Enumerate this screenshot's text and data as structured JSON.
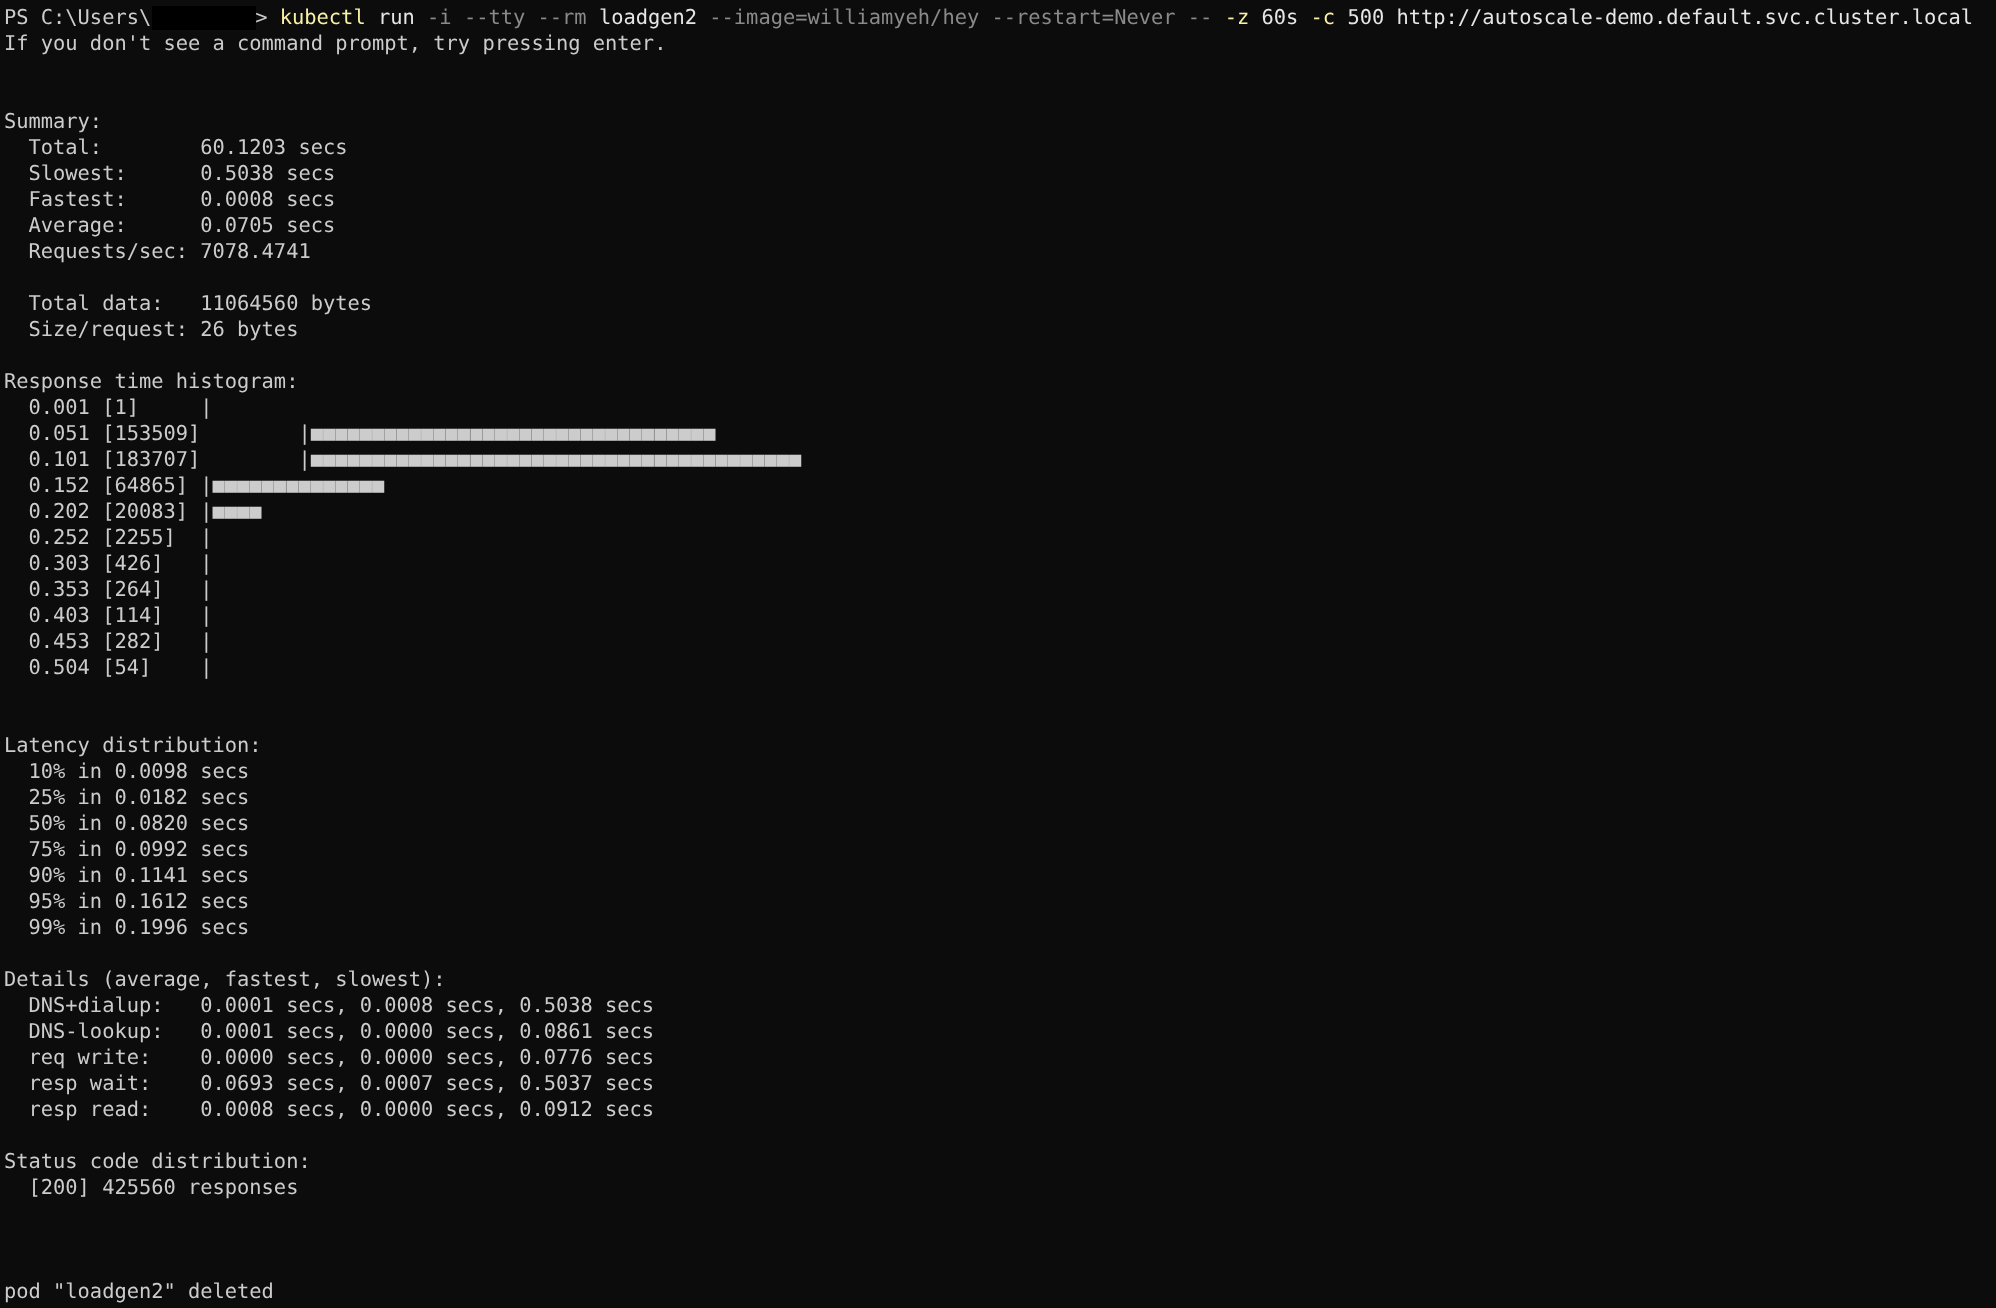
{
  "prompt": {
    "text": "PS C:\\Users\\",
    "redacted": true,
    "end": "> "
  },
  "command": [
    {
      "text": "kubectl",
      "kind": "command"
    },
    {
      "text": "run",
      "kind": "argument"
    },
    {
      "text": "-i",
      "kind": "flag"
    },
    {
      "text": "--tty",
      "kind": "flag"
    },
    {
      "text": "--rm",
      "kind": "flag"
    },
    {
      "text": "loadgen2",
      "kind": "argument"
    },
    {
      "text": "--image=williamyeh/hey",
      "kind": "flag"
    },
    {
      "text": "--restart=Never",
      "kind": "flag"
    },
    {
      "text": "--",
      "kind": "flag"
    },
    {
      "text": "-z",
      "kind": "parameter"
    },
    {
      "text": "60s",
      "kind": "argument"
    },
    {
      "text": "-c",
      "kind": "parameter"
    },
    {
      "text": "500",
      "kind": "argument"
    },
    {
      "text": "http://autoscale-demo.default.svc.cluster.local",
      "kind": "argument"
    }
  ],
  "output": [
    {
      "lines": [
        "If you don't see a command prompt, try pressing enter."
      ]
    },
    {
      "lines": [
        "Summary:",
        "  Total:        60.1203 secs",
        "  Slowest:      0.5038 secs",
        "  Fastest:      0.0008 secs",
        "  Average:      0.0705 secs",
        "  Requests/sec: 7078.4741"
      ]
    },
    {
      "lines": [
        "  Total data:   11064560 bytes",
        "  Size/request: 26 bytes"
      ]
    },
    {
      "histogram": {
        "title": "Response time histogram:",
        "rows": [
          "  0.001 [1]     |",
          "  0.051 [153509]        |■■■■■■■■■■■■■■■■■■■■■■■■■■■■■■■■■",
          "  0.101 [183707]        |■■■■■■■■■■■■■■■■■■■■■■■■■■■■■■■■■■■■■■■■",
          "  0.152 [64865] |■■■■■■■■■■■■■■",
          "  0.202 [20083] |■■■■",
          "  0.252 [2255]  |",
          "  0.303 [426]   |",
          "  0.353 [264]   |",
          "  0.403 [114]   |",
          "  0.453 [282]   |",
          "  0.504 [54]    |"
        ]
      }
    },
    {
      "lines": [
        "Latency distribution:",
        "  10% in 0.0098 secs",
        "  25% in 0.0182 secs",
        "  50% in 0.0820 secs",
        "  75% in 0.0992 secs",
        "  90% in 0.1141 secs",
        "  95% in 0.1612 secs",
        "  99% in 0.1996 secs"
      ]
    },
    {
      "lines": [
        "Details (average, fastest, slowest):",
        "  DNS+dialup:   0.0001 secs, 0.0008 secs, 0.5038 secs",
        "  DNS-lookup:   0.0001 secs, 0.0000 secs, 0.0861 secs",
        "  req write:    0.0000 secs, 0.0000 secs, 0.0776 secs",
        "  resp wait:    0.0693 secs, 0.0007 secs, 0.5037 secs",
        "  resp read:    0.0008 secs, 0.0000 secs, 0.0912 secs"
      ]
    },
    {
      "lines": [
        "Status code distribution:",
        "  [200] 425560 responses"
      ]
    },
    {
      "lines": [
        "pod \"loadgen2\" deleted"
      ]
    }
  ]
}
